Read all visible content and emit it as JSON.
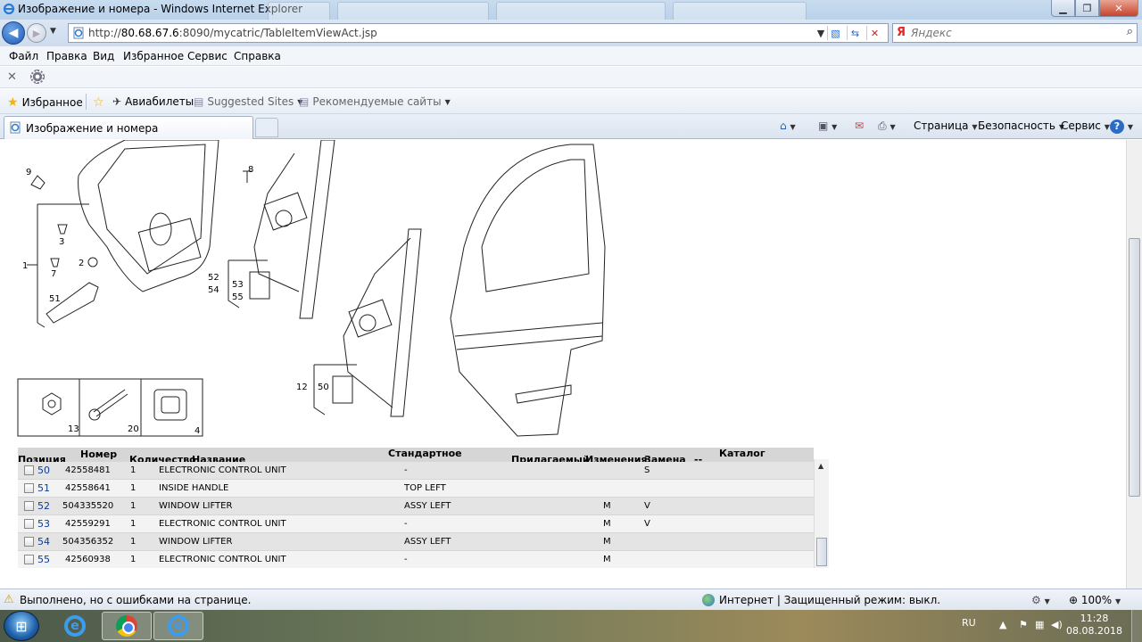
{
  "window": {
    "title": "Изображение и номера - Windows Internet Explorer"
  },
  "address": {
    "url_prefix": "http://",
    "url_host": "80.68.67.6",
    "url_rest": ":8090/mycatric/TableItemViewAct.jsp",
    "search_placeholder": "Яндекс",
    "search_brand": "Я"
  },
  "menu": [
    "Файл",
    "Правка",
    "Вид",
    "Избранное",
    "Сервис",
    "Справка"
  ],
  "favorites": {
    "favorites_label": "Избранное",
    "item1": "Авиабилеты",
    "item2": "Suggested Sites",
    "item3": "Рекомендуемые сайты"
  },
  "tab": {
    "title": "Изображение и номера"
  },
  "tools": {
    "page": "Страница",
    "safety": "Безопасность",
    "service": "Сервис"
  },
  "diagram": {
    "callouts": [
      "9",
      "3",
      "1",
      "2",
      "7",
      "51",
      "8",
      "52",
      "54",
      "53",
      "55",
      "12",
      "50",
      "13",
      "20",
      "4"
    ]
  },
  "table": {
    "headers": {
      "position": "Позиция",
      "number": "Номер",
      "quantity": "Количество",
      "name": "Название",
      "standard": "Стандартное",
      "applicable": "Прилагаемый",
      "changes": "Изменения",
      "replacement": "Замена",
      "dashes": "--",
      "catalog": "Каталог"
    },
    "rows": [
      {
        "pos": "50",
        "number": "42558481",
        "qty": "1",
        "name": "ELECTRONIC CONTROL UNIT",
        "standard": "-",
        "changes": "",
        "replacement": "S"
      },
      {
        "pos": "51",
        "number": "42558641",
        "qty": "1",
        "name": "INSIDE HANDLE",
        "standard": "TOP LEFT",
        "changes": "",
        "replacement": ""
      },
      {
        "pos": "52",
        "number": "504335520",
        "qty": "1",
        "name": "WINDOW LIFTER",
        "standard": "ASSY LEFT",
        "changes": "M",
        "replacement": "V"
      },
      {
        "pos": "53",
        "number": "42559291",
        "qty": "1",
        "name": "ELECTRONIC CONTROL UNIT",
        "standard": "-",
        "changes": "M",
        "replacement": "V"
      },
      {
        "pos": "54",
        "number": "504356352",
        "qty": "1",
        "name": "WINDOW LIFTER",
        "standard": "ASSY LEFT",
        "changes": "M",
        "replacement": ""
      },
      {
        "pos": "55",
        "number": "42560938",
        "qty": "1",
        "name": "ELECTRONIC CONTROL UNIT",
        "standard": "-",
        "changes": "M",
        "replacement": ""
      }
    ]
  },
  "status": {
    "message": "Выполнено, но с ошибками на странице.",
    "zone": "Интернет | Защищенный режим: выкл.",
    "zoom": "100%"
  },
  "taskbar": {
    "lang": "RU",
    "time": "11:28",
    "date": "08.08.2018"
  }
}
